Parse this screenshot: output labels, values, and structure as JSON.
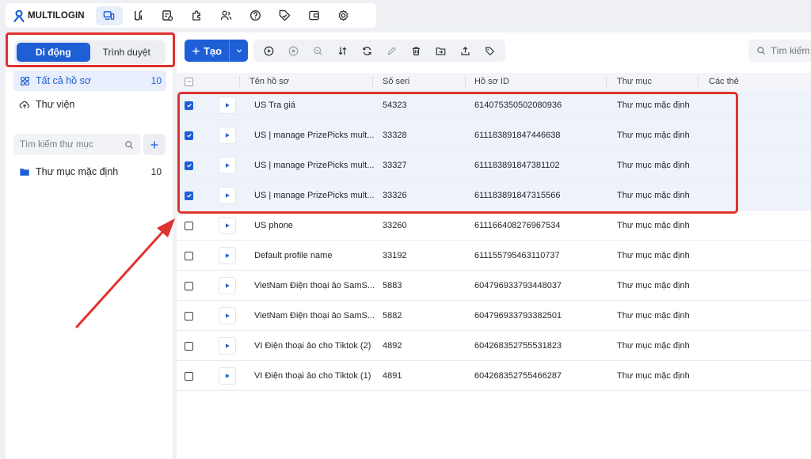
{
  "app": {
    "name": "MULTILOGIN"
  },
  "colors": {
    "accent": "#1e5fd6",
    "highlight": "#e0322e"
  },
  "topnav": {
    "icons": [
      "devices-icon",
      "routes-icon",
      "profiles-icon",
      "extensions-icon",
      "team-icon",
      "help-icon",
      "tag-icon",
      "wallet-icon",
      "settings-icon"
    ]
  },
  "sidebar": {
    "toggle": {
      "mobile": "Di động",
      "browser": "Trình duyệt"
    },
    "all_profiles": {
      "label": "Tất cả hồ sơ",
      "count": "10"
    },
    "library": {
      "label": "Thư viện"
    },
    "folder_search_placeholder": "Tìm kiếm thư mục",
    "folders": [
      {
        "label": "Thư mục mặc định",
        "count": "10"
      }
    ]
  },
  "toolbar": {
    "create_label": "Tạo",
    "search_placeholder": "Tìm kiếm"
  },
  "table": {
    "columns": [
      "Tên hồ sơ",
      "Số seri",
      "Hồ sơ ID",
      "Thư mục",
      "Các thẻ"
    ],
    "rows": [
      {
        "name": "US Tra giá",
        "serial": "54323",
        "id": "614075350502080936",
        "folder": "Thư mục mặc định",
        "checked": true
      },
      {
        "name": "US | manage PrizePicks mult...",
        "serial": "33328",
        "id": "611183891847446638",
        "folder": "Thư mục mặc định",
        "checked": true
      },
      {
        "name": "US | manage PrizePicks mult...",
        "serial": "33327",
        "id": "611183891847381102",
        "folder": "Thư mục mặc định",
        "checked": true
      },
      {
        "name": "US | manage PrizePicks mult...",
        "serial": "33326",
        "id": "611183891847315566",
        "folder": "Thư mục mặc định",
        "checked": true
      },
      {
        "name": "US phone",
        "serial": "33260",
        "id": "611166408276967534",
        "folder": "Thư mục mặc định",
        "checked": false
      },
      {
        "name": "Default profile name",
        "serial": "33192",
        "id": "611155795463110737",
        "folder": "Thư mục mặc định",
        "checked": false
      },
      {
        "name": "VietNam Điện thoại ảo SamS...",
        "serial": "5883",
        "id": "604796933793448037",
        "folder": "Thư mục mặc định",
        "checked": false
      },
      {
        "name": "VietNam Điện thoại ảo SamS...",
        "serial": "5882",
        "id": "604796933793382501",
        "folder": "Thư mục mặc định",
        "checked": false
      },
      {
        "name": "VI Điện thoại ảo cho Tiktok (2)",
        "serial": "4892",
        "id": "604268352755531823",
        "folder": "Thư mục mặc định",
        "checked": false
      },
      {
        "name": "VI Điện thoại ảo cho Tiktok (1)",
        "serial": "4891",
        "id": "604268352755466287",
        "folder": "Thư mục mặc định",
        "checked": false
      }
    ]
  }
}
